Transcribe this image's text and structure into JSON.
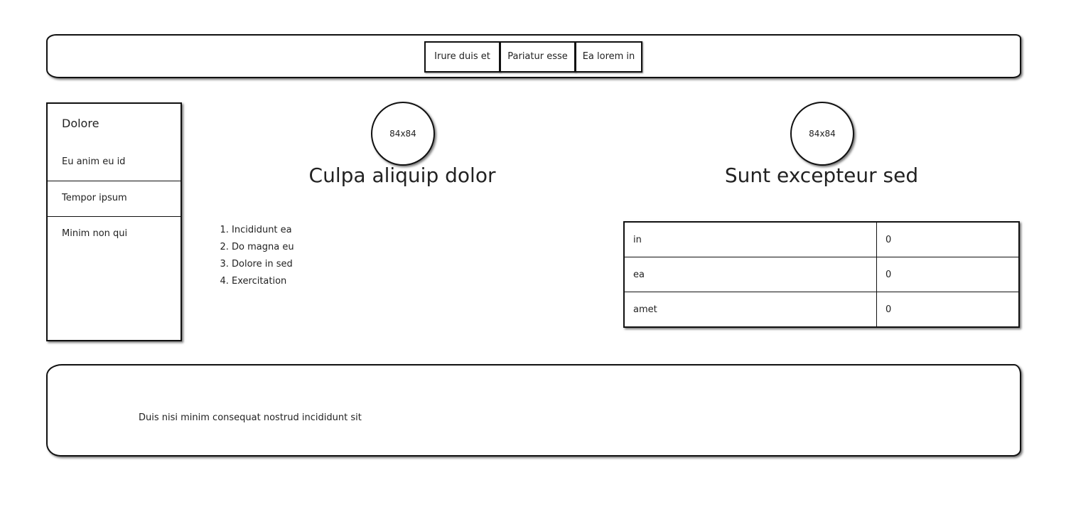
{
  "nav": {
    "items": [
      "Irure duis et",
      "Pariatur esse",
      "Ea lorem in"
    ]
  },
  "sidebar": {
    "title": "Dolore",
    "items": [
      "Eu anim eu id",
      "Tempor ipsum",
      "Minim non qui"
    ]
  },
  "cards": [
    {
      "avatar_label": "84x84",
      "title": "Culpa aliquip dolor",
      "list": [
        "Incididunt ea",
        "Do magna eu",
        "Dolore in sed",
        "Exercitation"
      ]
    },
    {
      "avatar_label": "84x84",
      "title": "Sunt excepteur sed",
      "table": [
        [
          "in",
          "0"
        ],
        [
          "ea",
          "0"
        ],
        [
          "amet",
          "0"
        ]
      ]
    }
  ],
  "footer": {
    "text": "Duis nisi minim consequat nostrud incididunt sit"
  }
}
